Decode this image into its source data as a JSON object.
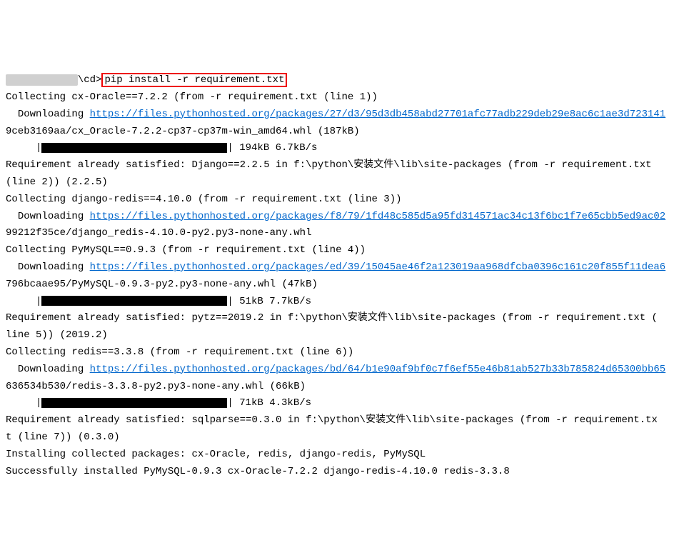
{
  "prompt": {
    "prefix_obscured": "____________",
    "path_suffix": "\\cd>",
    "command": "pip install -r requirement.txt"
  },
  "lines": {
    "l1": "Collecting cx-Oracle==7.2.2 (from -r requirement.txt (line 1))",
    "l2_prefix": "  Downloading ",
    "l2_link": "https://files.pythonhosted.org/packages/27/d3/95d3db458abd27701afc77adb229deb29e8ac6c1ae3d723141",
    "l3": "9ceb3169aa/cx_Oracle-7.2.2-cp37-cp37m-win_amd64.whl (187kB)",
    "l4_prefix": "     |",
    "l4_suffix": "| 194kB 6.7kB/s",
    "l5": "Requirement already satisfied: Django==2.2.5 in f:\\python\\安装文件\\lib\\site-packages (from -r requirement.txt",
    "l6": "(line 2)) (2.2.5)",
    "l7": "Collecting django-redis==4.10.0 (from -r requirement.txt (line 3))",
    "l8_prefix": "  Downloading ",
    "l8_link": "https://files.pythonhosted.org/packages/f8/79/1fd48c585d5a95fd314571ac34c13f6bc1f7e65cbb5ed9ac02",
    "l9": "99212f35ce/django_redis-4.10.0-py2.py3-none-any.whl",
    "l10": "Collecting PyMySQL==0.9.3 (from -r requirement.txt (line 4))",
    "l11_prefix": "  Downloading ",
    "l11_link": "https://files.pythonhosted.org/packages/ed/39/15045ae46f2a123019aa968dfcba0396c161c20f855f11dea6",
    "l12": "796bcaae95/PyMySQL-0.9.3-py2.py3-none-any.whl (47kB)",
    "l13_prefix": "     |",
    "l13_suffix": "| 51kB 7.7kB/s",
    "l14": "Requirement already satisfied: pytz==2019.2 in f:\\python\\安装文件\\lib\\site-packages (from -r requirement.txt (",
    "l15": "line 5)) (2019.2)",
    "l16": "Collecting redis==3.3.8 (from -r requirement.txt (line 6))",
    "l17_prefix": "  Downloading ",
    "l17_link": "https://files.pythonhosted.org/packages/bd/64/b1e90af9bf0c7f6ef55e46b81ab527b33b785824d65300bb65",
    "l18": "636534b530/redis-3.3.8-py2.py3-none-any.whl (66kB)",
    "l19_prefix": "     |",
    "l19_suffix": "| 71kB 4.3kB/s",
    "l20": "Requirement already satisfied: sqlparse==0.3.0 in f:\\python\\安装文件\\lib\\site-packages (from -r requirement.tx",
    "l21": "t (line 7)) (0.3.0)",
    "l22": "Installing collected packages: cx-Oracle, redis, django-redis, PyMySQL",
    "l23": "Successfully installed PyMySQL-0.9.3 cx-Oracle-7.2.2 django-redis-4.10.0 redis-3.3.8"
  }
}
